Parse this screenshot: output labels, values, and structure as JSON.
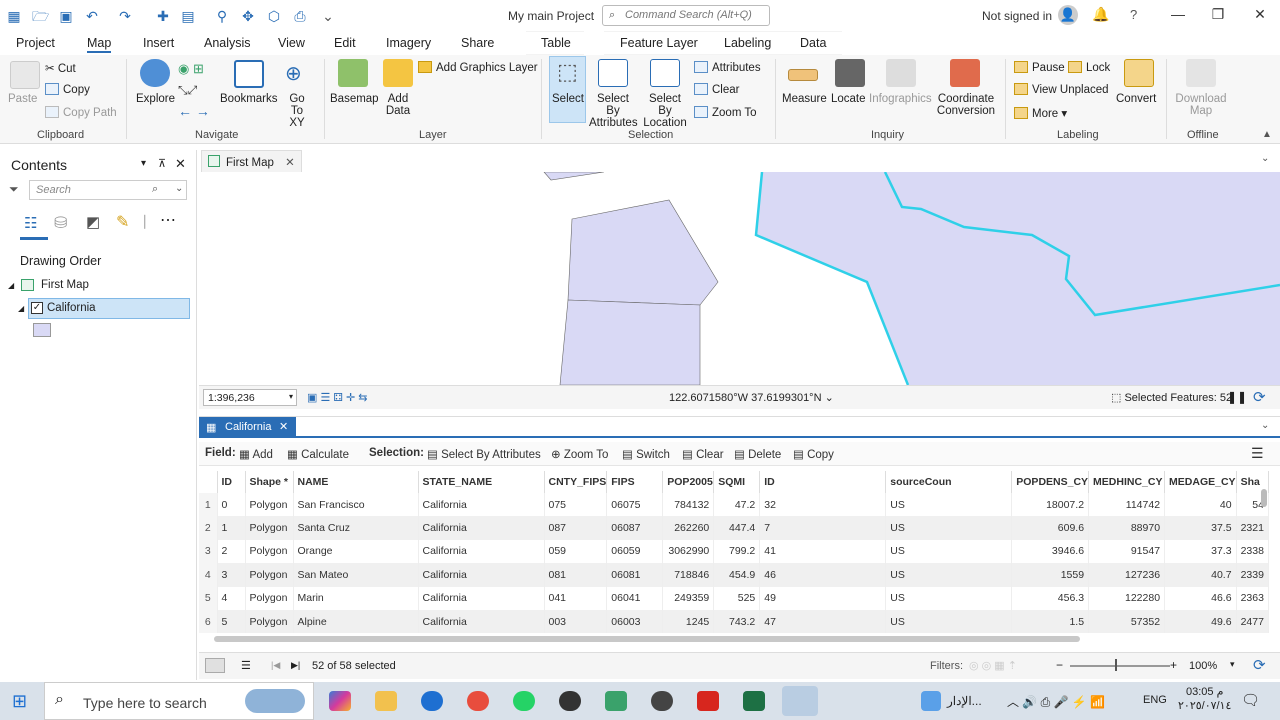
{
  "window": {
    "title": "My main Project",
    "command_search_placeholder": "Command Search (Alt+Q)",
    "signin": "Not signed in"
  },
  "tabs": [
    "Project",
    "Map",
    "Insert",
    "Analysis",
    "View",
    "Edit",
    "Imagery",
    "Share",
    "Table",
    "Feature Layer",
    "Labeling",
    "Data"
  ],
  "ribbon": {
    "clipboard": {
      "paste": "Paste",
      "cut": "Cut",
      "copy": "Copy",
      "copy_path": "Copy Path",
      "group": "Clipboard"
    },
    "navigate": {
      "explore": "Explore",
      "bookmarks": "Bookmarks",
      "goto": "Go To XY",
      "group": "Navigate"
    },
    "layer": {
      "basemap": "Basemap",
      "add_data": "Add Data",
      "add_graphics": "Add Graphics Layer",
      "group": "Layer"
    },
    "selection": {
      "select": "Select",
      "by_attr": "Select By Attributes",
      "by_loc": "Select By Location",
      "attributes": "Attributes",
      "clear": "Clear",
      "zoom_to": "Zoom To",
      "group": "Selection"
    },
    "inquiry": {
      "measure": "Measure",
      "locate": "Locate",
      "infographics": "Infographics",
      "coord": "Coordinate Conversion",
      "group": "Inquiry"
    },
    "labeling": {
      "pause": "Pause",
      "lock": "Lock",
      "view_unplaced": "View Unplaced",
      "more": "More",
      "convert": "Convert",
      "group": "Labeling"
    },
    "offline": {
      "download": "Download Map",
      "group": "Offline"
    }
  },
  "contents": {
    "title": "Contents",
    "search_placeholder": "Search",
    "drawing_order": "Drawing Order",
    "map_name": "First Map",
    "layer_name": "California"
  },
  "map": {
    "tab": "First Map",
    "scale": "1:396,236",
    "coords": "122.6071580°W 37.6199301°N",
    "selected_features": "Selected Features: 52"
  },
  "table": {
    "tab": "California",
    "toolbar": {
      "field": "Field:",
      "add": "Add",
      "calculate": "Calculate",
      "selection": "Selection:",
      "by_attr": "Select By Attributes",
      "zoom_to": "Zoom To",
      "switch": "Switch",
      "clear": "Clear",
      "delete": "Delete",
      "copy": "Copy"
    },
    "columns": [
      "ID",
      "Shape *",
      "NAME",
      "STATE_NAME",
      "CNTY_FIPS",
      "FIPS",
      "POP2005",
      "SQMI",
      "ID",
      "sourceCoun",
      "POPDENS_CY",
      "MEDHINC_CY",
      "MEDAGE_CY",
      "Sha"
    ],
    "rows": [
      [
        "1",
        "0",
        "Polygon",
        "San Francisco",
        "California",
        "075",
        "06075",
        "784132",
        "47.2",
        "32",
        "US",
        "18007.2",
        "114742",
        "40",
        "54"
      ],
      [
        "2",
        "1",
        "Polygon",
        "Santa Cruz",
        "California",
        "087",
        "06087",
        "262260",
        "447.4",
        "7",
        "US",
        "609.6",
        "88970",
        "37.5",
        "2321"
      ],
      [
        "3",
        "2",
        "Polygon",
        "Orange",
        "California",
        "059",
        "06059",
        "3062990",
        "799.2",
        "41",
        "US",
        "3946.6",
        "91547",
        "37.3",
        "2338"
      ],
      [
        "4",
        "3",
        "Polygon",
        "San Mateo",
        "California",
        "081",
        "06081",
        "718846",
        "454.9",
        "46",
        "US",
        "1559",
        "127236",
        "40.7",
        "2339"
      ],
      [
        "5",
        "4",
        "Polygon",
        "Marin",
        "California",
        "041",
        "06041",
        "249359",
        "525",
        "49",
        "US",
        "456.3",
        "122280",
        "46.6",
        "2363"
      ],
      [
        "6",
        "5",
        "Polygon",
        "Alpine",
        "California",
        "003",
        "06003",
        "1245",
        "743.2",
        "47",
        "US",
        "1.5",
        "57352",
        "49.6",
        "2477"
      ]
    ],
    "status": "52 of 58 selected",
    "filters": "Filters:",
    "zoom": "100%"
  },
  "taskbar": {
    "search": "Type here to search",
    "lang": "ENG",
    "time": "03:05 م",
    "date": "٢٠٢٥/٠٧/١٤",
    "arabic": "الإدار..."
  }
}
